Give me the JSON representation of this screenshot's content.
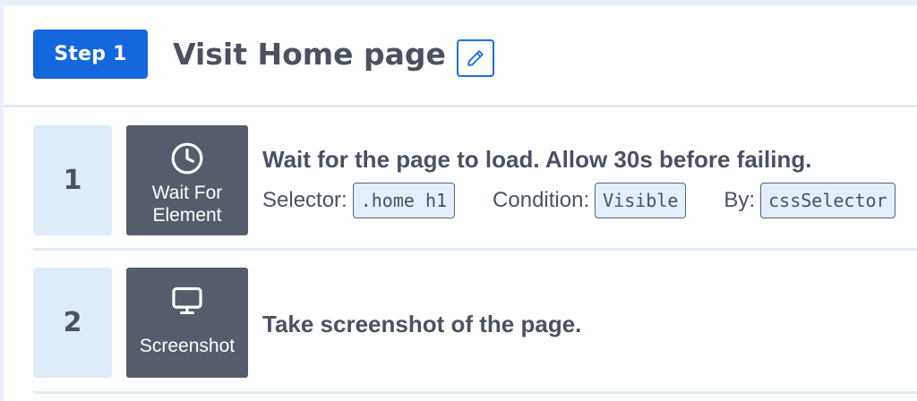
{
  "header": {
    "step_badge": "Step 1",
    "title": "Visit Home page",
    "edit_icon": "pencil-icon"
  },
  "steps": [
    {
      "number": "1",
      "type_icon": "clock-icon",
      "type_label_line1": "Wait For",
      "type_label_line2": "Element",
      "description": "Wait for the page to load. Allow 30s before failing.",
      "params": [
        {
          "label": "Selector:",
          "value": ".home h1"
        },
        {
          "label": "Condition:",
          "value": "Visible"
        },
        {
          "label": "By:",
          "value": "cssSelector"
        }
      ]
    },
    {
      "number": "2",
      "type_icon": "monitor-icon",
      "type_label": "Screenshot",
      "description": "Take screenshot of the page."
    }
  ],
  "colors": {
    "accent": "#1467dd",
    "type_box": "#555d6a",
    "number_box": "#deebf8",
    "code_bg": "#e3effa",
    "text": "#4a5261",
    "page_bg": "#e9f1fa"
  }
}
